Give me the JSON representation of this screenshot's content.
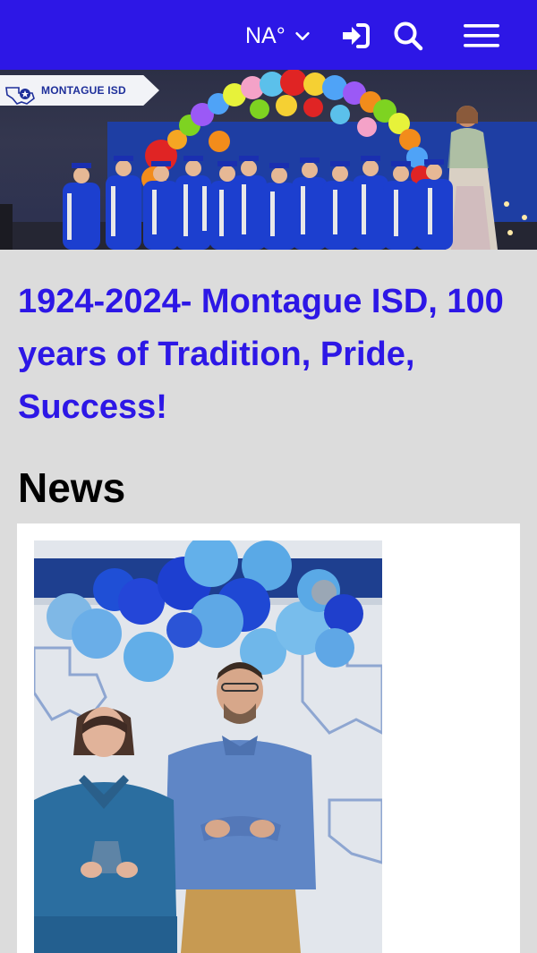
{
  "header": {
    "weather": "NA°",
    "icons": {
      "weather_toggle": "chevron-down-icon",
      "login": "sign-in-icon",
      "search": "search-icon",
      "menu": "hamburger-menu-icon"
    }
  },
  "hero": {
    "badge_text": "MONTAGUE ISD"
  },
  "headline": "1924-2024- Montague ISD, 100 years of Tradition, Pride, Success!",
  "news": {
    "title": "News"
  },
  "colors": {
    "brand_blue": "#2d17e6",
    "page_bg": "#dcdcdc"
  }
}
